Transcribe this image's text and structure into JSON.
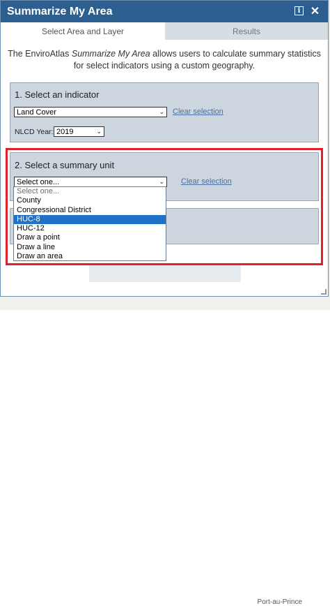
{
  "window": {
    "title": "Summarize My Area"
  },
  "tabs": [
    {
      "label": "Select Area and Layer",
      "active": true
    },
    {
      "label": "Results",
      "active": false
    }
  ],
  "intro": {
    "prefix": "The EnviroAtlas ",
    "italic": "Summarize My Area",
    "suffix": " allows users to calculate summary statistics for select indicators using a custom geography."
  },
  "step1": {
    "heading": "1. Select an indicator",
    "indicator_value": "Land Cover",
    "clear_label": "Clear selection",
    "nlcd_label": "NLCD Year:",
    "nlcd_value": "2019"
  },
  "step2": {
    "heading": "2. Select a summary unit",
    "unit_value": "Select one...",
    "clear_label": "Clear selection",
    "options": [
      "Select one...",
      "County",
      "Congressional District",
      "HUC-8",
      "HUC-12",
      "Draw a point",
      "Draw a line",
      "Draw an area"
    ],
    "highlighted_option": "HUC-8"
  },
  "map": {
    "city_label": "Port-au-Prince"
  },
  "colors": {
    "titlebar": "#2c5f8f",
    "section": "#cdd6df",
    "highlight_box": "#e0202a",
    "option_selected": "#1e73c8"
  }
}
